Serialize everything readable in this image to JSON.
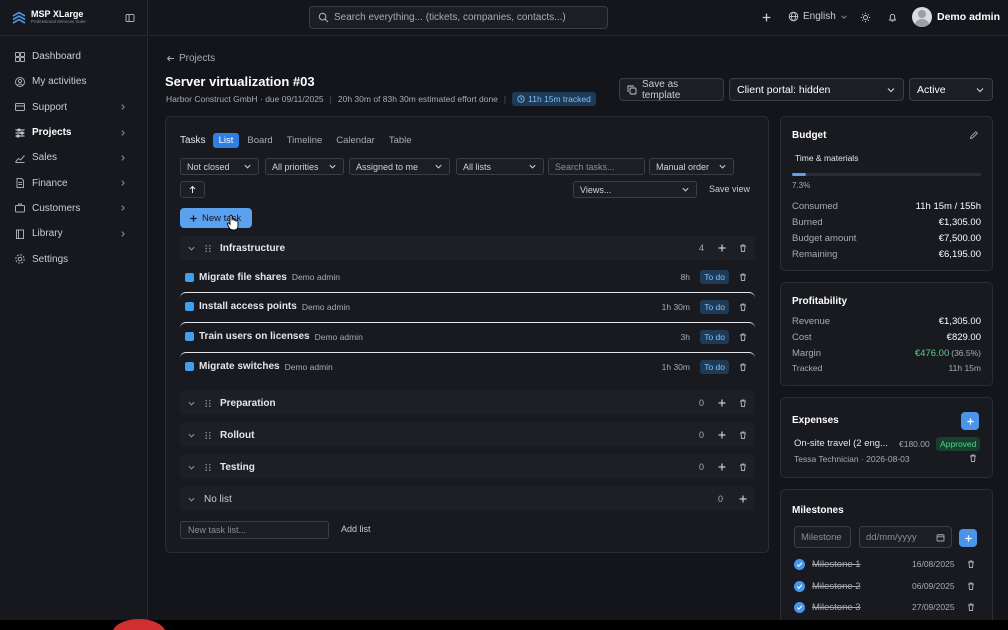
{
  "app": {
    "title": "MSP XLarge",
    "subtitle": "Professional Services Suite"
  },
  "sidebar": {
    "items": [
      {
        "label": "Dashboard",
        "icon": "dashboard-icon",
        "has_children": false
      },
      {
        "label": "My activities",
        "icon": "user-circle-icon",
        "has_children": false
      },
      {
        "label": "Support",
        "icon": "support-icon",
        "has_children": true
      },
      {
        "label": "Projects",
        "icon": "projects-icon",
        "has_children": true,
        "active": true
      },
      {
        "label": "Sales",
        "icon": "chart-icon",
        "has_children": true
      },
      {
        "label": "Finance",
        "icon": "document-icon",
        "has_children": true
      },
      {
        "label": "Customers",
        "icon": "customers-icon",
        "has_children": true
      },
      {
        "label": "Library",
        "icon": "book-icon",
        "has_children": true
      },
      {
        "label": "Settings",
        "icon": "gear-icon",
        "has_children": false
      }
    ]
  },
  "topbar": {
    "search_placeholder": "Search everything... (tickets, companies, contacts...)",
    "language": "English",
    "user_name": "Demo admin"
  },
  "header": {
    "back_label": "Projects",
    "title": "Server virtualization #03",
    "company_due": "Harbor Construct GmbH · due 09/11/2025",
    "effort": "20h 30m of 83h 30m estimated effort done",
    "tracked": "11h 15m tracked",
    "save_template_label": "Save as template",
    "client_portal": "Client portal: hidden",
    "status": "Active"
  },
  "tasks": {
    "label": "Tasks",
    "tabs": [
      "List",
      "Board",
      "Timeline",
      "Calendar",
      "Table"
    ],
    "active_tab": "List",
    "filters": {
      "closed": "Not closed",
      "priorities": "All priorities",
      "assigned": "Assigned to me",
      "lists": "All lists",
      "search_placeholder": "Search tasks...",
      "order": "Manual order",
      "views": "Views...",
      "save_view": "Save view"
    },
    "new_task_label": "New task",
    "groups": [
      {
        "name": "Infrastructure",
        "count": "4",
        "tasks": [
          {
            "name": "Migrate file shares",
            "owner": "Demo admin",
            "estimate": "8h",
            "status": "To do"
          },
          {
            "name": "Install access points",
            "owner": "Demo admin",
            "estimate": "1h 30m",
            "status": "To do"
          },
          {
            "name": "Train users on licenses",
            "owner": "Demo admin",
            "estimate": "3h",
            "status": "To do"
          },
          {
            "name": "Migrate switches",
            "owner": "Demo admin",
            "estimate": "1h 30m",
            "status": "To do"
          }
        ]
      },
      {
        "name": "Preparation",
        "count": "0"
      },
      {
        "name": "Rollout",
        "count": "0"
      },
      {
        "name": "Testing",
        "count": "0"
      },
      {
        "name": "No list",
        "count": "0"
      }
    ],
    "new_list_placeholder": "New task list...",
    "add_list_label": "Add list"
  },
  "budget": {
    "title": "Budget",
    "type": "Time & materials",
    "progress_pct": 7.3,
    "progress_label": "7.3%",
    "rows": [
      {
        "label": "Consumed",
        "value": "11h 15m / 155h"
      },
      {
        "label": "Burned",
        "value": "€1,305.00"
      },
      {
        "label": "Budget amount",
        "value": "€7,500.00"
      },
      {
        "label": "Remaining",
        "value": "€6,195.00"
      }
    ]
  },
  "profitability": {
    "title": "Profitability",
    "revenue_label": "Revenue",
    "revenue": "€1,305.00",
    "cost_label": "Cost",
    "cost": "€829.00",
    "margin_label": "Margin",
    "margin": "€476.00",
    "margin_pct": "(36.5%)",
    "tracked_label": "Tracked",
    "tracked": "11h 15m"
  },
  "expenses": {
    "title": "Expenses",
    "items": [
      {
        "name": "On-site travel (2 eng...",
        "amount": "€180.00",
        "status": "Approved",
        "meta": "Tessa Technician · 2026-08-03"
      }
    ]
  },
  "milestones": {
    "title": "Milestones",
    "name_placeholder": "Milestone",
    "date_placeholder": "dd/mm/yyyy",
    "items": [
      {
        "name": "Milestone 1",
        "date": "16/08/2025"
      },
      {
        "name": "Milestone 2",
        "date": "06/09/2025"
      },
      {
        "name": "Milestone 3",
        "date": "27/09/2025"
      }
    ]
  },
  "colors": {
    "accent": "#4a95ea",
    "success": "#57d18b",
    "background": "#13151a"
  }
}
